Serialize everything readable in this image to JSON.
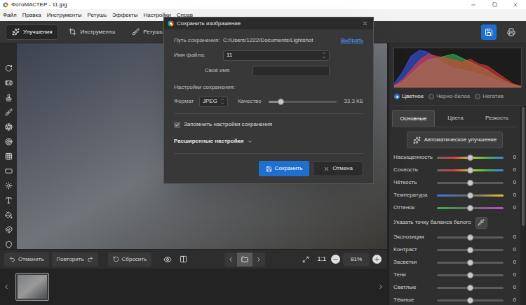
{
  "window": {
    "title": "ФотоМАСТЕР - 11.jpg"
  },
  "menu": [
    "Файл",
    "Правка",
    "Инструменты",
    "Ретушь",
    "Эффекты",
    "Настройки",
    "Справ"
  ],
  "toolbar_tabs": [
    {
      "label": "Улучшения",
      "selected": true
    },
    {
      "label": "Инструменты",
      "selected": false
    },
    {
      "label": "Ретушь",
      "selected": false
    }
  ],
  "histogram": {
    "series": [
      {
        "color": "#3a5cff",
        "values": [
          10,
          40,
          80,
          95,
          90,
          75,
          60,
          50,
          45,
          40,
          35,
          28,
          20,
          12,
          5,
          2
        ]
      },
      {
        "color": "#34d058",
        "values": [
          3,
          15,
          35,
          55,
          70,
          75,
          80,
          85,
          75,
          65,
          55,
          45,
          30,
          18,
          8,
          2
        ]
      },
      {
        "color": "#ff3a3a",
        "values": [
          5,
          20,
          45,
          70,
          85,
          80,
          75,
          70,
          65,
          72,
          60,
          55,
          40,
          25,
          10,
          3
        ]
      }
    ]
  },
  "color_modes": [
    {
      "label": "Цветное",
      "selected": true
    },
    {
      "label": "Черно-белое",
      "selected": false
    },
    {
      "label": "Негатив",
      "selected": false
    }
  ],
  "panel_tabs": [
    {
      "label": "Основные",
      "selected": true
    },
    {
      "label": "Цвета",
      "selected": false
    },
    {
      "label": "Резкость",
      "selected": false
    }
  ],
  "auto_button": "Автоматическое улучшение",
  "adjustments": [
    {
      "kind": "slider",
      "label": "Насыщенность",
      "value": "0",
      "level": 0.5,
      "colors": [
        "#6a6a6a",
        "#d04040",
        "#d8c838",
        "#40b848",
        "#4080e0"
      ]
    },
    {
      "kind": "slider",
      "label": "Сочность",
      "value": "0",
      "level": 0.5,
      "colors": [
        "#6a6a6a",
        "#d04040",
        "#d8c838",
        "#40b848",
        "#4080e0"
      ]
    },
    {
      "kind": "slider",
      "label": "Чёткость",
      "value": "0",
      "level": 0.5,
      "colors": [
        "#5c5c5c",
        "#5c5c5c"
      ]
    },
    {
      "kind": "slider",
      "label": "Температура",
      "value": "0",
      "level": 0.5,
      "colors": [
        "#3a78d8",
        "#6a6a6a",
        "#e0c030"
      ]
    },
    {
      "kind": "slider",
      "label": "Оттенок",
      "value": "0",
      "level": 0.5,
      "colors": [
        "#3db34a",
        "#6a6a6a",
        "#c04ad0"
      ]
    },
    {
      "kind": "picker",
      "label": "Указать точку баланса белого"
    },
    {
      "kind": "slider",
      "label": "Экспозиция",
      "value": "0",
      "level": 0.5,
      "colors": [
        "#5c5c5c",
        "#5c5c5c"
      ]
    },
    {
      "kind": "slider",
      "label": "Контраст",
      "value": "0",
      "level": 0.5,
      "colors": [
        "#5c5c5c",
        "#5c5c5c"
      ]
    },
    {
      "kind": "slider",
      "label": "Засветки",
      "value": "0",
      "level": 0.5,
      "colors": [
        "#5c5c5c",
        "#5c5c5c"
      ]
    },
    {
      "kind": "slider",
      "label": "Тени",
      "value": "0",
      "level": 0.5,
      "colors": [
        "#5c5c5c",
        "#5c5c5c"
      ]
    },
    {
      "kind": "slider",
      "label": "Светлые",
      "value": "0",
      "level": 0.5,
      "colors": [
        "#5c5c5c",
        "#5c5c5c"
      ]
    },
    {
      "kind": "slider",
      "label": "Тёмные",
      "value": "0",
      "level": 0.5,
      "colors": [
        "#5c5c5c",
        "#5c5c5c"
      ]
    }
  ],
  "history": {
    "undo": "Отменить",
    "redo": "Повторить",
    "reset": "Сбросить"
  },
  "nav": {
    "folder_active": true
  },
  "zoom": {
    "ratio": "1:1",
    "value": "81%"
  },
  "filmstrip": [
    {
      "selected": true
    }
  ],
  "dialog": {
    "title": "Сохранить изображение",
    "path": {
      "label": "Путь сохранения:",
      "value": "C:/Users/1222/Documents/Lightshot",
      "link": "Выбрать"
    },
    "file_name": {
      "label": "Имя файла:",
      "value": "11"
    },
    "custom_name": {
      "label": "Своё имя",
      "value": ""
    },
    "settings_heading": "Настройки сохранения:",
    "format": {
      "label": "Формат",
      "value": "JPEG"
    },
    "quality": {
      "label": "Качество",
      "level": 0.18,
      "size": "33.3 КБ"
    },
    "remember": {
      "label": "Запомнить настройки сохранения",
      "checked": true
    },
    "advanced": {
      "label": "Расширенные настройки",
      "expanded": false
    },
    "buttons": [
      {
        "label": "Сохранить",
        "primary": true
      },
      {
        "label": "Отмена",
        "primary": false
      }
    ]
  }
}
